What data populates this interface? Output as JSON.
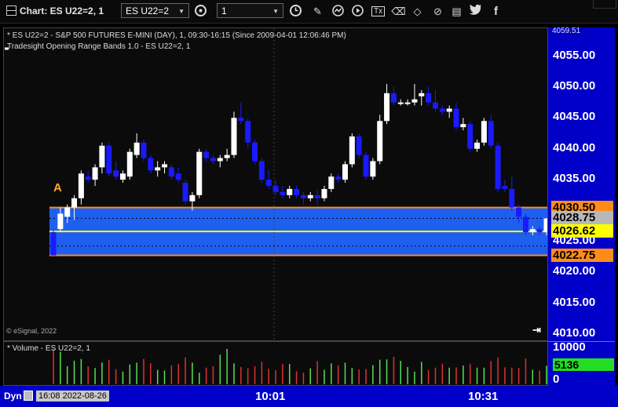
{
  "toolbar": {
    "title": "Chart: ES U22=2, 1",
    "symbol": "ES U22=2",
    "interval": "1",
    "icons": [
      "clock-icon",
      "draw-icon",
      "study-icon",
      "play-icon",
      "text-icon",
      "eraser-icon",
      "cursor-icon",
      "note-icon",
      "twitter-icon",
      "facebook-icon"
    ]
  },
  "header": {
    "line1": "* ES U22=2 - S&P 500 FUTURES E-MINI (DAY), 1, 09:30-16:15 (Since 2009-04-01 12:06:46 PM)",
    "line2": "Tradesight Opening Range Bands 1.0 - ES U22=2, 1"
  },
  "copyright": "© eSignal, 2022",
  "volume_header": "* Volume - ES U22=2, 1",
  "marker_a": "A",
  "bottom_bar": {
    "dyn": "Dyn",
    "datetime": "16:08 2022-08-26",
    "time_labels": [
      "10:01",
      "10:31"
    ]
  },
  "price_axis": {
    "top_value": "4059.51",
    "ticks": [
      "4055.00",
      "4050.00",
      "4045.00",
      "4040.00",
      "4035.00",
      "4025.00",
      "4020.00",
      "4015.00",
      "4010.00"
    ],
    "tags": [
      {
        "value": "4030.50",
        "color": "#ff8c1a"
      },
      {
        "value": "4028.75",
        "color": "#b8b8b8"
      },
      {
        "value": "4026.62",
        "color": "#ffff00"
      },
      {
        "value": "4022.75",
        "color": "#ff8c1a"
      }
    ]
  },
  "volume_axis": {
    "ticks": [
      "10000",
      "0"
    ],
    "last": "5136",
    "last_color": "#22dd22"
  },
  "chart_data": {
    "type": "candlestick",
    "ylim": [
      4009,
      4059.51
    ],
    "opening_range": {
      "high": 4030.5,
      "mid": 4026.62,
      "low": 4022.75
    },
    "last_price": 4028.75,
    "candles": [
      {
        "o": 4026.5,
        "h": 4027.0,
        "l": 4022.75,
        "c": 4022.75
      },
      {
        "o": 4027.0,
        "h": 4030.5,
        "l": 4026.5,
        "c": 4029.5
      },
      {
        "o": 4029.0,
        "h": 4031.0,
        "l": 4028.0,
        "c": 4030.5
      },
      {
        "o": 4030.5,
        "h": 4032.5,
        "l": 4028.5,
        "c": 4032.0
      },
      {
        "o": 4032.0,
        "h": 4036.5,
        "l": 4031.0,
        "c": 4036.0
      },
      {
        "o": 4035.5,
        "h": 4036.5,
        "l": 4034.5,
        "c": 4035.0
      },
      {
        "o": 4035.0,
        "h": 4037.5,
        "l": 4034.0,
        "c": 4037.0
      },
      {
        "o": 4037.0,
        "h": 4041.0,
        "l": 4036.0,
        "c": 4040.5
      },
      {
        "o": 4040.5,
        "h": 4041.0,
        "l": 4035.5,
        "c": 4036.0
      },
      {
        "o": 4036.5,
        "h": 4038.0,
        "l": 4035.0,
        "c": 4035.5
      },
      {
        "o": 4035.0,
        "h": 4036.5,
        "l": 4034.5,
        "c": 4036.0
      },
      {
        "o": 4035.5,
        "h": 4040.0,
        "l": 4035.0,
        "c": 4039.5
      },
      {
        "o": 4039.0,
        "h": 4042.5,
        "l": 4038.5,
        "c": 4041.0
      },
      {
        "o": 4041.0,
        "h": 4041.5,
        "l": 4038.0,
        "c": 4038.5
      },
      {
        "o": 4038.5,
        "h": 4039.0,
        "l": 4036.0,
        "c": 4036.5
      },
      {
        "o": 4036.5,
        "h": 4038.0,
        "l": 4035.5,
        "c": 4037.0
      },
      {
        "o": 4037.0,
        "h": 4038.0,
        "l": 4036.0,
        "c": 4037.5
      },
      {
        "o": 4037.0,
        "h": 4037.5,
        "l": 4035.0,
        "c": 4035.5
      },
      {
        "o": 4036.0,
        "h": 4037.0,
        "l": 4034.5,
        "c": 4035.0
      },
      {
        "o": 4034.5,
        "h": 4035.0,
        "l": 4031.0,
        "c": 4031.5
      },
      {
        "o": 4031.5,
        "h": 4033.0,
        "l": 4030.0,
        "c": 4032.5
      },
      {
        "o": 4032.5,
        "h": 4040.0,
        "l": 4032.0,
        "c": 4039.5
      },
      {
        "o": 4039.5,
        "h": 4040.0,
        "l": 4038.0,
        "c": 4038.5
      },
      {
        "o": 4038.5,
        "h": 4039.0,
        "l": 4037.5,
        "c": 4038.0
      },
      {
        "o": 4038.0,
        "h": 4039.0,
        "l": 4037.0,
        "c": 4038.5
      },
      {
        "o": 4038.5,
        "h": 4040.0,
        "l": 4038.0,
        "c": 4039.0
      },
      {
        "o": 4039.0,
        "h": 4046.0,
        "l": 4038.5,
        "c": 4045.0
      },
      {
        "o": 4045.0,
        "h": 4047.5,
        "l": 4044.0,
        "c": 4044.5
      },
      {
        "o": 4044.5,
        "h": 4045.0,
        "l": 4040.0,
        "c": 4041.0
      },
      {
        "o": 4041.0,
        "h": 4041.5,
        "l": 4037.5,
        "c": 4038.0
      },
      {
        "o": 4038.0,
        "h": 4038.5,
        "l": 4034.5,
        "c": 4035.0
      },
      {
        "o": 4035.0,
        "h": 4036.5,
        "l": 4033.5,
        "c": 4034.0
      },
      {
        "o": 4034.0,
        "h": 4035.0,
        "l": 4032.5,
        "c": 4033.0
      },
      {
        "o": 4033.0,
        "h": 4034.0,
        "l": 4032.0,
        "c": 4032.5
      },
      {
        "o": 4032.5,
        "h": 4034.0,
        "l": 4032.0,
        "c": 4033.5
      },
      {
        "o": 4033.5,
        "h": 4034.0,
        "l": 4032.0,
        "c": 4032.5
      },
      {
        "o": 4032.5,
        "h": 4033.0,
        "l": 4031.0,
        "c": 4032.0
      },
      {
        "o": 4032.0,
        "h": 4033.0,
        "l": 4031.5,
        "c": 4032.5
      },
      {
        "o": 4032.5,
        "h": 4033.5,
        "l": 4031.0,
        "c": 4032.0
      },
      {
        "o": 4032.0,
        "h": 4034.0,
        "l": 4031.5,
        "c": 4033.5
      },
      {
        "o": 4033.5,
        "h": 4036.0,
        "l": 4033.0,
        "c": 4035.5
      },
      {
        "o": 4035.5,
        "h": 4036.0,
        "l": 4034.5,
        "c": 4035.0
      },
      {
        "o": 4035.0,
        "h": 4038.0,
        "l": 4034.5,
        "c": 4037.5
      },
      {
        "o": 4037.5,
        "h": 4042.5,
        "l": 4037.0,
        "c": 4042.0
      },
      {
        "o": 4042.0,
        "h": 4042.5,
        "l": 4038.5,
        "c": 4039.0
      },
      {
        "o": 4039.0,
        "h": 4039.5,
        "l": 4035.0,
        "c": 4035.5
      },
      {
        "o": 4035.5,
        "h": 4038.5,
        "l": 4035.0,
        "c": 4038.0
      },
      {
        "o": 4038.0,
        "h": 4045.5,
        "l": 4037.5,
        "c": 4044.5
      },
      {
        "o": 4044.5,
        "h": 4050.5,
        "l": 4044.0,
        "c": 4049.0
      },
      {
        "o": 4049.0,
        "h": 4050.0,
        "l": 4047.0,
        "c": 4047.5
      },
      {
        "o": 4047.5,
        "h": 4048.0,
        "l": 4047.0,
        "c": 4047.5
      },
      {
        "o": 4047.5,
        "h": 4048.0,
        "l": 4047.0,
        "c": 4047.5
      },
      {
        "o": 4047.5,
        "h": 4050.5,
        "l": 4047.0,
        "c": 4048.0
      },
      {
        "o": 4048.5,
        "h": 4049.5,
        "l": 4047.0,
        "c": 4049.0
      },
      {
        "o": 4049.0,
        "h": 4050.0,
        "l": 4047.0,
        "c": 4047.5
      },
      {
        "o": 4047.5,
        "h": 4049.5,
        "l": 4046.0,
        "c": 4046.5
      },
      {
        "o": 4046.5,
        "h": 4047.0,
        "l": 4045.5,
        "c": 4046.0
      },
      {
        "o": 4046.0,
        "h": 4047.0,
        "l": 4045.0,
        "c": 4046.5
      },
      {
        "o": 4046.5,
        "h": 4047.5,
        "l": 4043.0,
        "c": 4043.5
      },
      {
        "o": 4043.5,
        "h": 4045.0,
        "l": 4043.0,
        "c": 4044.0
      },
      {
        "o": 4044.0,
        "h": 4044.5,
        "l": 4039.5,
        "c": 4040.0
      },
      {
        "o": 4040.0,
        "h": 4041.5,
        "l": 4039.5,
        "c": 4041.0
      },
      {
        "o": 4041.0,
        "h": 4045.0,
        "l": 4040.5,
        "c": 4044.5
      },
      {
        "o": 4044.5,
        "h": 4045.5,
        "l": 4040.0,
        "c": 4040.5
      },
      {
        "o": 4040.5,
        "h": 4041.0,
        "l": 4033.0,
        "c": 4033.5
      },
      {
        "o": 4034.0,
        "h": 4035.0,
        "l": 4033.0,
        "c": 4033.5
      },
      {
        "o": 4033.5,
        "h": 4035.5,
        "l": 4030.0,
        "c": 4030.5
      },
      {
        "o": 4030.5,
        "h": 4031.0,
        "l": 4028.0,
        "c": 4029.0
      },
      {
        "o": 4029.0,
        "h": 4029.5,
        "l": 4026.0,
        "c": 4026.5
      },
      {
        "o": 4026.5,
        "h": 4027.5,
        "l": 4026.0,
        "c": 4027.0
      },
      {
        "o": 4027.0,
        "h": 4027.5,
        "l": 4026.0,
        "c": 4026.5
      },
      {
        "o": 4026.5,
        "h": 4028.75,
        "l": 4026.0,
        "c": 4028.75
      }
    ],
    "volume": [
      9800,
      9000,
      5000,
      6500,
      7000,
      5000,
      4500,
      6000,
      6800,
      4200,
      3500,
      5500,
      6000,
      7000,
      5800,
      4000,
      3800,
      5200,
      5600,
      7400,
      6000,
      3200,
      4600,
      5000,
      8200,
      9800,
      5800,
      4800,
      4400,
      5000,
      6200,
      4300,
      3900,
      5600,
      5600,
      3600,
      3200,
      4400,
      6400,
      4000,
      5800,
      5200,
      6000,
      4500,
      4100,
      4200,
      5300,
      6800,
      6900,
      7600,
      6500,
      4800,
      3500,
      6200,
      3900,
      4600,
      5700,
      4600,
      4700,
      5200,
      5600,
      4600,
      4600,
      6400,
      7400,
      4700,
      4600,
      4500,
      7100,
      4000,
      3800,
      5136
    ]
  }
}
